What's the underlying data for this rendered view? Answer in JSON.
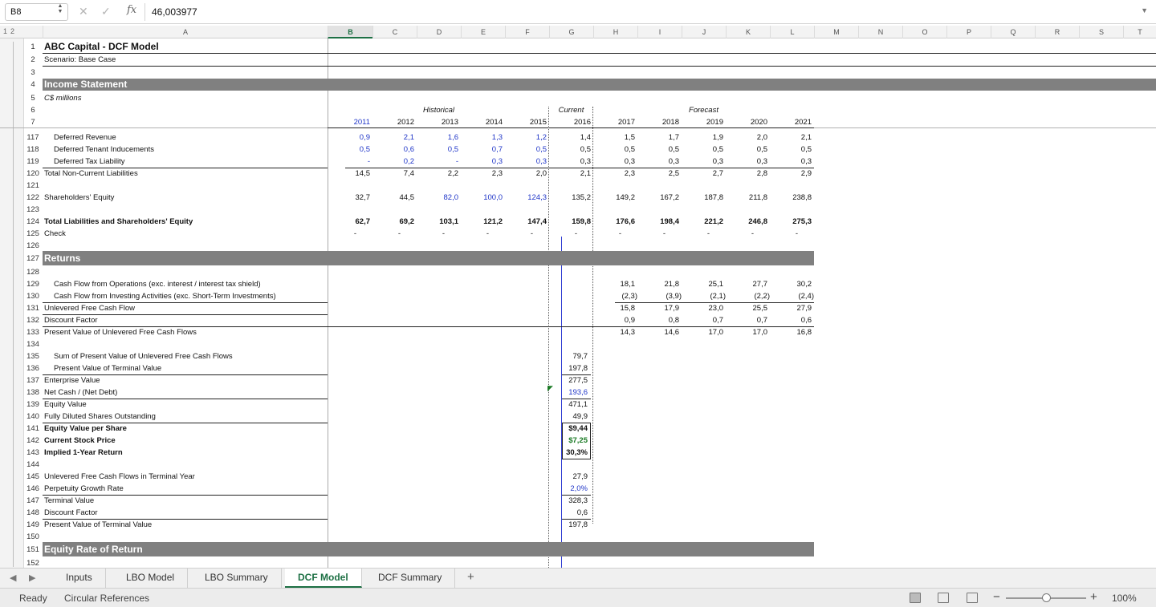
{
  "formula_bar": {
    "cell_ref": "B8",
    "value": "46,003977"
  },
  "outline_levels": [
    "1",
    "2"
  ],
  "columns": [
    "A",
    "B",
    "C",
    "D",
    "E",
    "F",
    "G",
    "H",
    "I",
    "J",
    "K",
    "L",
    "M",
    "N",
    "O",
    "P",
    "Q",
    "R",
    "S",
    "T"
  ],
  "selected_column": "B",
  "header_rows": {
    "r1": {
      "num": "1",
      "label": "ABC Capital - DCF Model"
    },
    "r2": {
      "num": "2",
      "label": "Scenario: Base Case"
    },
    "r3": {
      "num": "3"
    },
    "r4": {
      "num": "4",
      "label": "Income Statement"
    },
    "r5": {
      "num": "5",
      "label": "C$ millions"
    },
    "r6": {
      "num": "6",
      "historical": "Historical",
      "current": "Current",
      "forecast": "Forecast"
    },
    "r7": {
      "num": "7",
      "years": [
        "2011",
        "2012",
        "2013",
        "2014",
        "2015",
        "2016",
        "2017",
        "2018",
        "2019",
        "2020",
        "2021"
      ]
    }
  },
  "rows": {
    "r117": {
      "num": "117",
      "label": "Deferred Revenue",
      "values": [
        "0,9",
        "2,1",
        "1,6",
        "1,3",
        "1,2",
        "1,4",
        "1,5",
        "1,7",
        "1,9",
        "2,0",
        "2,1"
      ]
    },
    "r118": {
      "num": "118",
      "label": "Deferred Tenant Inducements",
      "values": [
        "0,5",
        "0,6",
        "0,5",
        "0,7",
        "0,5",
        "0,5",
        "0,5",
        "0,5",
        "0,5",
        "0,5",
        "0,5"
      ]
    },
    "r119": {
      "num": "119",
      "label": "Deferred Tax Liability",
      "values": [
        "-",
        "0,2",
        "-",
        "0,3",
        "0,3",
        "0,3",
        "0,3",
        "0,3",
        "0,3",
        "0,3",
        "0,3"
      ]
    },
    "r120": {
      "num": "120",
      "label": "Total Non-Current Liabilities",
      "values": [
        "14,5",
        "7,4",
        "2,2",
        "2,3",
        "2,0",
        "2,1",
        "2,3",
        "2,5",
        "2,7",
        "2,8",
        "2,9"
      ]
    },
    "r121": {
      "num": "121"
    },
    "r122": {
      "num": "122",
      "label": "Shareholders' Equity",
      "values": [
        "32,7",
        "44,5",
        "82,0",
        "100,0",
        "124,3",
        "135,2",
        "149,2",
        "167,2",
        "187,8",
        "211,8",
        "238,8"
      ]
    },
    "r123": {
      "num": "123"
    },
    "r124": {
      "num": "124",
      "label": "Total Liabilities and Shareholders' Equity",
      "values": [
        "62,7",
        "69,2",
        "103,1",
        "121,2",
        "147,4",
        "159,8",
        "176,6",
        "198,4",
        "221,2",
        "246,8",
        "275,3"
      ]
    },
    "r125": {
      "num": "125",
      "label": "Check",
      "values": [
        "-",
        "-",
        "-",
        "-",
        "-",
        "-",
        "-",
        "-",
        "-",
        "-",
        "-"
      ]
    },
    "r126": {
      "num": "126"
    },
    "r127": {
      "num": "127",
      "label": "Returns"
    },
    "r128": {
      "num": "128"
    },
    "r129": {
      "num": "129",
      "label": "Cash Flow from Operations (exc. interest / interest tax shield)",
      "values": [
        "18,1",
        "21,8",
        "25,1",
        "27,7",
        "30,2"
      ]
    },
    "r130": {
      "num": "130",
      "label": "Cash Flow from Investing Activities (exc. Short-Term Investments)",
      "values": [
        "(2,3)",
        "(3,9)",
        "(2,1)",
        "(2,2)",
        "(2,4)"
      ]
    },
    "r131": {
      "num": "131",
      "label": "Unlevered Free Cash Flow",
      "values": [
        "15,8",
        "17,9",
        "23,0",
        "25,5",
        "27,9"
      ]
    },
    "r132": {
      "num": "132",
      "label": "Discount Factor",
      "values": [
        "0,9",
        "0,8",
        "0,7",
        "0,7",
        "0,6"
      ]
    },
    "r133": {
      "num": "133",
      "label": "Present Value of Unlevered Free Cash Flows",
      "values": [
        "14,3",
        "14,6",
        "17,0",
        "17,0",
        "16,8"
      ]
    },
    "r134": {
      "num": "134"
    },
    "r135": {
      "num": "135",
      "label": "Sum of Present Value of Unlevered Free Cash Flows",
      "value": "79,7"
    },
    "r136": {
      "num": "136",
      "label": "Present Value of Terminal Value",
      "value": "197,8"
    },
    "r137": {
      "num": "137",
      "label": "Enterprise Value",
      "value": "277,5"
    },
    "r138": {
      "num": "138",
      "label": "Net Cash / (Net Debt)",
      "value": "193,6"
    },
    "r139": {
      "num": "139",
      "label": "Equity Value",
      "value": "471,1"
    },
    "r140": {
      "num": "140",
      "label": "Fully Diluted Shares Outstanding",
      "value": "49,9"
    },
    "r141": {
      "num": "141",
      "label": "Equity Value per Share",
      "value": "$9,44"
    },
    "r142": {
      "num": "142",
      "label": "Current Stock Price",
      "value": "$7,25"
    },
    "r143": {
      "num": "143",
      "label": "Implied 1-Year Return",
      "value": "30,3%"
    },
    "r144": {
      "num": "144"
    },
    "r145": {
      "num": "145",
      "label": "Unlevered Free Cash Flows in Terminal Year",
      "value": "27,9"
    },
    "r146": {
      "num": "146",
      "label": "Perpetuity Growth Rate",
      "value": "2,0%"
    },
    "r147": {
      "num": "147",
      "label": "Terminal Value",
      "value": "328,3"
    },
    "r148": {
      "num": "148",
      "label": "Discount Factor",
      "value": "0,6"
    },
    "r149": {
      "num": "149",
      "label": "Present Value of Terminal Value",
      "value": "197,8"
    },
    "r150": {
      "num": "150"
    },
    "r151": {
      "num": "151",
      "label": "Equity Rate of Return"
    },
    "r152": {
      "num": "152"
    }
  },
  "tabs": [
    "Inputs",
    "LBO Model",
    "LBO Summary",
    "DCF Model",
    "DCF Summary"
  ],
  "active_tab": "DCF Model",
  "status": {
    "ready": "Ready",
    "circular": "Circular References",
    "zoom": "100%"
  },
  "colors": {
    "accent": "#1d7044",
    "section_fill": "#808080",
    "input_blue": "#1f35c8",
    "link_green": "#1a7a24"
  }
}
